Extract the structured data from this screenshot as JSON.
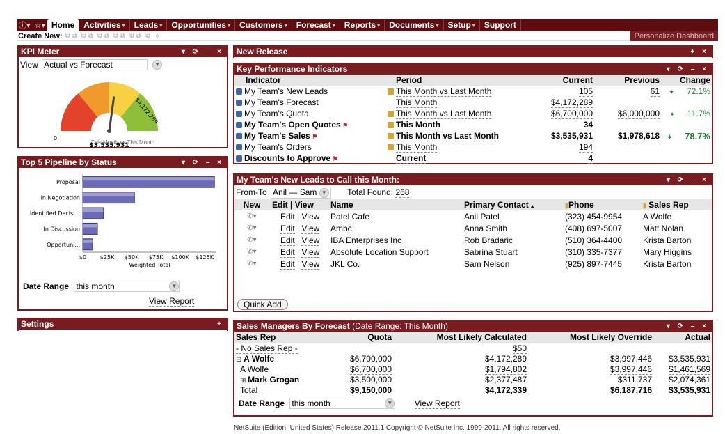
{
  "nav": {
    "tabs": [
      {
        "label": "Home",
        "dropdown": false
      },
      {
        "label": "Activities",
        "dropdown": true
      },
      {
        "label": "Leads",
        "dropdown": true
      },
      {
        "label": "Opportunities",
        "dropdown": true
      },
      {
        "label": "Customers",
        "dropdown": true
      },
      {
        "label": "Forecast",
        "dropdown": true
      },
      {
        "label": "Reports",
        "dropdown": true
      },
      {
        "label": "Documents",
        "dropdown": true
      },
      {
        "label": "Setup",
        "dropdown": true
      },
      {
        "label": "Support",
        "dropdown": false
      }
    ],
    "create_new": "Create New:",
    "personalize": "Personalize Dashboard"
  },
  "kpi_meter": {
    "title": "KPI Meter",
    "view_label": "View",
    "view_value": "Actual vs Forecast",
    "gauge_zero": "0",
    "gauge_max": "$4,172,289",
    "gauge_value": "$3,535,931",
    "gauge_caption": "This Month vs This Month",
    "gauge_fraction": 0.847
  },
  "pipeline": {
    "title": "Top 5 Pipeline by Status",
    "date_range_label": "Date Range",
    "date_range_value": "this month",
    "view_report": "View Report",
    "chart_data": {
      "type": "bar",
      "categories": [
        "Proposal",
        "In Negotiation",
        "Identified Decisi...",
        "In Discussion",
        "Opportuni..."
      ],
      "values": [
        135000,
        53000,
        21000,
        15000,
        10000
      ],
      "xlabel": "Weighted Total",
      "xlim": [
        0,
        137000
      ],
      "xticks": [
        "$0",
        "$25K",
        "$50K",
        "$75K",
        "$100K",
        "$125K"
      ],
      "xtick_values": [
        0,
        25000,
        50000,
        75000,
        100000,
        125000
      ],
      "bar_color": "#6b6bb8"
    }
  },
  "settings": {
    "title": "Settings"
  },
  "new_release": {
    "title": "New Release"
  },
  "kpi": {
    "title": "Key Performance Indicators",
    "headers": [
      "Indicator",
      "Period",
      "Current",
      "Previous",
      "Change"
    ],
    "rows": [
      {
        "indicator": "My Team's New Leads",
        "period": "This Month vs Last Month",
        "current": "105",
        "previous": "61",
        "change": "72.1%",
        "bold": false,
        "flag": false,
        "compare": true
      },
      {
        "indicator": "My Team's Forecast",
        "period": "This Month",
        "current": "$4,172,289",
        "previous": "",
        "change": "",
        "bold": false,
        "flag": false,
        "compare": false
      },
      {
        "indicator": "My Team's Quota",
        "period": "This Month vs Last Month",
        "current": "$6,700,000",
        "previous": "$6,000,000",
        "change": "11.7%",
        "bold": false,
        "flag": false,
        "compare": true
      },
      {
        "indicator": "My Team's Open Quotes",
        "period": "This Month",
        "current": "34",
        "previous": "",
        "change": "",
        "bold": true,
        "flag": true,
        "compare": true
      },
      {
        "indicator": "My Team's Sales",
        "period": "This Month vs Last Month",
        "current": "$3,535,931",
        "previous": "$1,978,618",
        "change": "78.7%",
        "bold": true,
        "flag": true,
        "compare": true
      },
      {
        "indicator": "My Team's Orders",
        "period": "This Month",
        "current": "194",
        "previous": "",
        "change": "",
        "bold": false,
        "flag": false,
        "compare": true
      },
      {
        "indicator": "Discounts to Approve",
        "period": "Current",
        "current": "4",
        "previous": "",
        "change": "",
        "bold": true,
        "flag": true,
        "compare": false
      }
    ]
  },
  "leads": {
    "title": "My Team's New Leads to Call this Month:",
    "from_to_label": "From-To",
    "from_to_value": "Anil — Sam",
    "total_found_label": "Total Found:",
    "total_found": "268",
    "headers": [
      "New",
      "Edit | View",
      "Name",
      "Primary Contact",
      "Phone",
      "Sales Rep"
    ],
    "edit_label": "Edit",
    "view_label": "View",
    "rows": [
      {
        "name": "Patel Cafe",
        "contact": "Anil Patel",
        "phone": "(323) 454-9954",
        "rep": "A Wolfe"
      },
      {
        "name": "Ambc",
        "contact": "Anna Smith",
        "phone": "(408) 697-5007",
        "rep": "Matt Nolan"
      },
      {
        "name": "IBA Enterprises Inc",
        "contact": "Rob Bradaric",
        "phone": "(510) 364-4400",
        "rep": "Krista Barton"
      },
      {
        "name": "Absolute Location Support",
        "contact": "Sabrina Stuart",
        "phone": "(310) 335-7377",
        "rep": "Mary Higgins"
      },
      {
        "name": "JKL Co.",
        "contact": "Sam Nelson",
        "phone": "(925) 897-7445",
        "rep": "Krista Barton"
      }
    ],
    "quick_add": "Quick Add"
  },
  "forecast": {
    "title": "Sales Managers By Forecast",
    "subtitle": "(Date Range: This Month)",
    "headers": [
      "Sales Rep",
      "Quota",
      "Most Likely Calculated",
      "Most Likely Override",
      "Actual"
    ],
    "rows": [
      {
        "rep": "- No Sales Rep -",
        "quota": "",
        "calc": "$50",
        "override": "",
        "actual": "",
        "bold": false,
        "prefix": "",
        "indent": false
      },
      {
        "rep": "A Wolfe",
        "quota": "$6,700,000",
        "calc": "$4,172,289",
        "override": "$3,997,446",
        "actual": "$3,535,931",
        "bold": true,
        "prefix": "⊟",
        "indent": false
      },
      {
        "rep": "A Wolfe",
        "quota": "$6,700,000",
        "calc": "$1,794,802",
        "override": "$3,997,446",
        "actual": "$1,461,569",
        "bold": false,
        "prefix": "",
        "indent": true
      },
      {
        "rep": "Mark Grogan",
        "quota": "$3,500,000",
        "calc": "$2,377,487",
        "override": "$311,737",
        "actual": "$2,074,361",
        "bold": true,
        "prefix": "⊞",
        "indent": true
      },
      {
        "rep": "Total",
        "quota": "$9,150,000",
        "calc": "$4,172,339",
        "override": "$6,187,716",
        "actual": "$3,535,931",
        "bold": false,
        "prefix": "",
        "indent": true,
        "total": true
      }
    ],
    "date_range_label": "Date Range",
    "date_range_value": "this month",
    "view_report": "View Report"
  },
  "footer": "NetSuite (Edition: United States) Release 2011.1 Copyright © NetSuite Inc. 1999-2011. All rights reserved."
}
